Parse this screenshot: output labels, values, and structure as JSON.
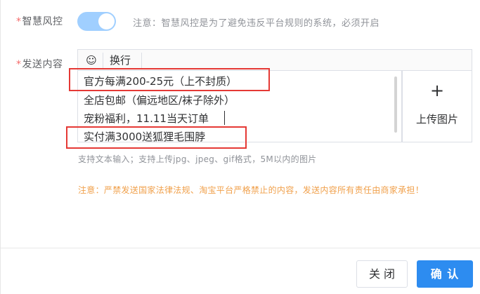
{
  "risk_control": {
    "required_mark": "*",
    "label": "智慧风控",
    "enabled": true,
    "note": "注意：智慧风控是为了避免违反平台规则的系统，必须开启"
  },
  "content": {
    "required_mark": "*",
    "label": "发送内容",
    "toolbar": {
      "emoji_icon": "☺",
      "line_break_label": "换行"
    },
    "lines": [
      "官方每满200-25元（上不封质）",
      "全店包邮（偏远地区/袜子除外）",
      "宠粉福利，11.11当天订单",
      "实付满3000送狐狸毛围脖"
    ],
    "upload": {
      "plus_icon": "+",
      "label": "上传图片"
    },
    "hint": "支持文本输入；支持上传jpg、jpeg、gif格式，5M以内的图片",
    "warning": "注意：严禁发送国家法律法规、淘宝平台严格禁止的内容，发送内容所有责任由商家承担！"
  },
  "footer": {
    "close_label": "关 闭",
    "confirm_label": "确 认"
  },
  "colors": {
    "primary": "#2d8cf0",
    "toggle_on": "#a0cfff",
    "warning": "#f0a04b",
    "required": "#f56c6c",
    "annotation_red": "#e53935"
  }
}
